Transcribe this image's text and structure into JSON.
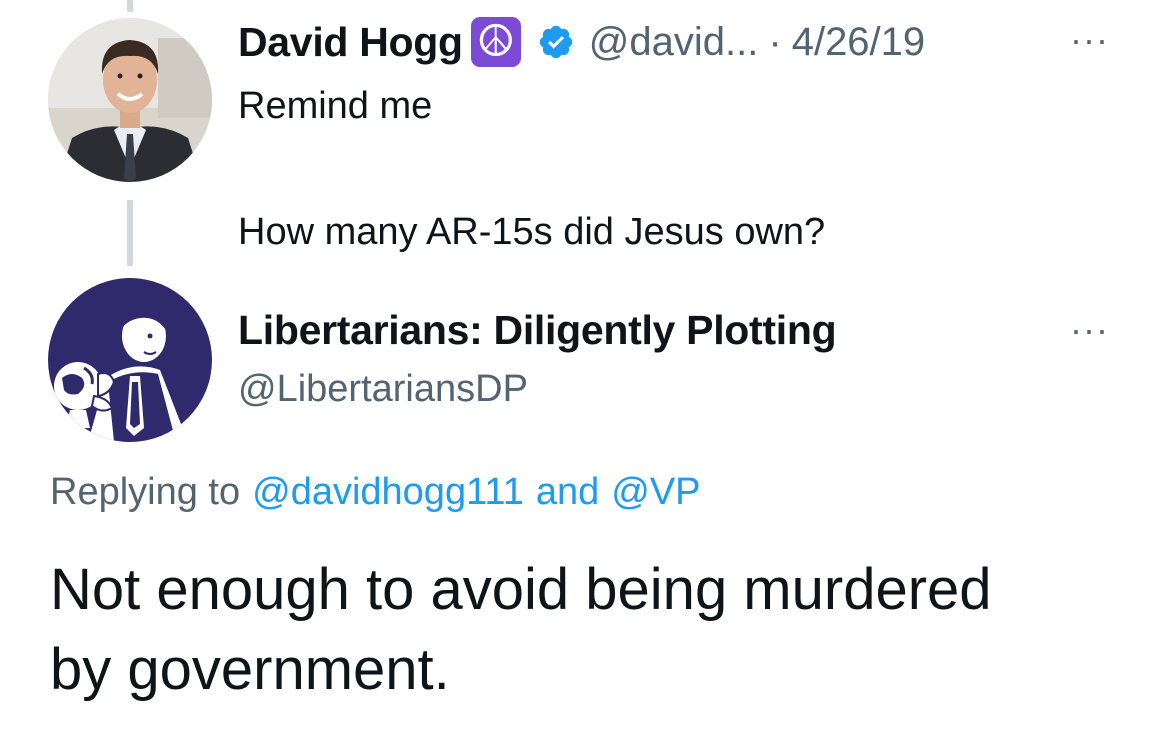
{
  "parent_tweet": {
    "author_name": "David Hogg",
    "name_emoji": "☮",
    "handle_truncated": "@david...",
    "separator": "·",
    "date": "4/26/19",
    "more_label": "···",
    "text_line_1": "Remind me",
    "text_line_2": "How many AR-15s did Jesus own?"
  },
  "reply_tweet": {
    "author_name": "Libertarians: Diligently Plotting",
    "handle": "@LibertariansDP",
    "more_label": "···",
    "replying_prefix": "Replying to",
    "reply_mention_1": "@davidhogg111",
    "reply_and": "and",
    "reply_mention_2": "@VP",
    "text_line_1": "Not enough to avoid being murdered",
    "text_line_2": "by government."
  },
  "colors": {
    "link": "#1d9bf0",
    "muted": "#536471",
    "thread_line": "#cfd9de",
    "verified": "#1d9bf0",
    "peace_badge": "#7d4ad6",
    "avatar_bg_libertarian": "#2e2a6b"
  },
  "icons": {
    "verified": "verified-badge-icon",
    "peace": "peace-symbol-icon",
    "more": "more-options-icon"
  }
}
